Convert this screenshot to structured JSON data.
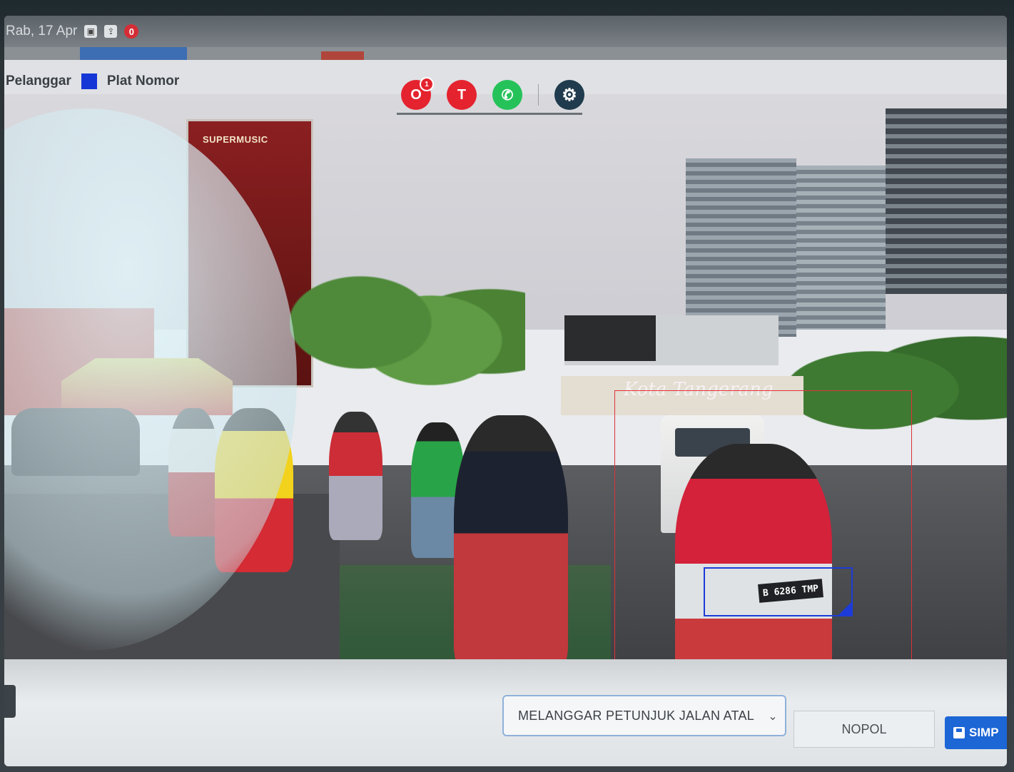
{
  "status_bar": {
    "date": "Rab, 17 Apr",
    "notification_count": "0"
  },
  "legend": {
    "violator_label": "Pelanggar",
    "plate_label": "Plat Nomor",
    "plate_color": "#1537d6"
  },
  "camera": {
    "billboard_brand": "SUPERMUSIC",
    "gate_text": "Kota Tangerang",
    "detected_plate": "B 6286 TMP",
    "violator_box_color": "#e0303a",
    "plate_box_color": "#1d3bd8"
  },
  "form": {
    "violation_type": "MELANGGAR PETUNJUK JALAN ATAL",
    "plate_placeholder": "NOPOL",
    "save_label": "SIMP"
  },
  "dock": {
    "app1_badge": "1",
    "icons": [
      "opera-icon",
      "transit-icon",
      "whatsapp-icon",
      "settings-icon"
    ]
  }
}
